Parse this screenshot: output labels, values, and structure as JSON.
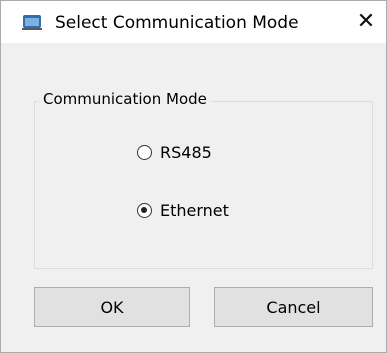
{
  "window": {
    "title": "Select Communication Mode",
    "close_glyph": "✕",
    "icon": "app-window-icon"
  },
  "group": {
    "legend": "Communication Mode",
    "options": [
      {
        "label": "RS485",
        "selected": false
      },
      {
        "label": "Ethernet",
        "selected": true
      }
    ]
  },
  "buttons": {
    "ok_label": "OK",
    "cancel_label": "Cancel"
  },
  "colors": {
    "window_bg": "#f0f0f0",
    "titlebar_bg": "#ffffff",
    "button_bg": "#e1e1e1",
    "icon_blue": "#2f6fb0"
  }
}
